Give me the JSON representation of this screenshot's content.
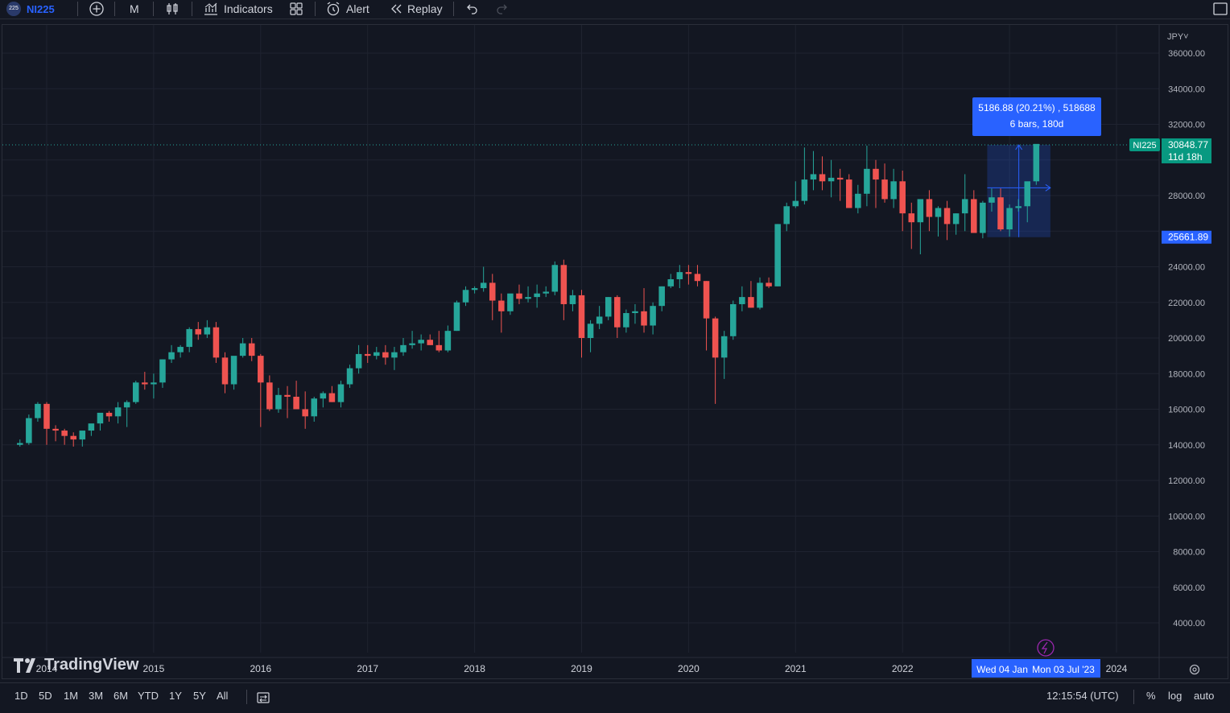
{
  "toolbar": {
    "symbol_badge": "225",
    "symbol": "NI225",
    "interval": "M",
    "indicators": "Indicators",
    "alert": "Alert",
    "replay": "Replay"
  },
  "chart_data": {
    "type": "candlestick",
    "currency": "JPY",
    "x_ticks": [
      "2014",
      "2015",
      "2016",
      "2017",
      "2018",
      "2019",
      "2020",
      "2021",
      "2022",
      "2024"
    ],
    "y_ticks": [
      "36000.00",
      "34000.00",
      "32000.00",
      "28000.00",
      "24000.00",
      "22000.00",
      "20000.00",
      "18000.00",
      "16000.00",
      "14000.00",
      "12000.00",
      "10000.00",
      "8000.00",
      "6000.00",
      "4000.00"
    ],
    "ylim": [
      3200,
      37000
    ],
    "colors": {
      "up": "#26a69a",
      "down": "#ef5350",
      "background": "#131722",
      "grid": "#1f2330"
    },
    "start": "2013-10",
    "ohlc": [
      [
        14000,
        14300,
        13900,
        14100
      ],
      [
        14100,
        15700,
        14000,
        15500
      ],
      [
        15500,
        16400,
        15300,
        16300
      ],
      [
        16300,
        16400,
        14000,
        14900
      ],
      [
        14900,
        15100,
        14200,
        14800
      ],
      [
        14800,
        14900,
        14000,
        14500
      ],
      [
        14500,
        14700,
        13900,
        14300
      ],
      [
        14300,
        14500,
        13900,
        14800
      ],
      [
        14800,
        15000,
        14500,
        15200
      ],
      [
        15200,
        15700,
        14800,
        15800
      ],
      [
        15800,
        15900,
        15300,
        15600
      ],
      [
        15600,
        16400,
        15200,
        16100
      ],
      [
        16100,
        16500,
        15000,
        16400
      ],
      [
        16400,
        17600,
        16300,
        17500
      ],
      [
        17500,
        18100,
        17100,
        17400
      ],
      [
        17400,
        18000,
        16600,
        17500
      ],
      [
        17500,
        18800,
        17200,
        18800
      ],
      [
        18800,
        19600,
        18600,
        19200
      ],
      [
        19200,
        19600,
        18900,
        19500
      ],
      [
        19500,
        20600,
        19200,
        20500
      ],
      [
        20500,
        20900,
        19900,
        20200
      ],
      [
        20200,
        21000,
        20000,
        20600
      ],
      [
        20600,
        20900,
        18600,
        18900
      ],
      [
        18900,
        19200,
        16900,
        17400
      ],
      [
        17400,
        18800,
        17100,
        19000
      ],
      [
        19000,
        20000,
        18900,
        19700
      ],
      [
        19700,
        20000,
        18700,
        19000
      ],
      [
        19000,
        19100,
        15000,
        17500
      ],
      [
        17500,
        17900,
        15900,
        16000
      ],
      [
        16000,
        17200,
        15800,
        16800
      ],
      [
        16800,
        17300,
        15500,
        16700
      ],
      [
        16700,
        17600,
        16000,
        16000
      ],
      [
        16000,
        17000,
        14900,
        15600
      ],
      [
        15600,
        16700,
        15300,
        16600
      ],
      [
        16600,
        17000,
        16100,
        16900
      ],
      [
        16900,
        17300,
        16400,
        16400
      ],
      [
        16400,
        17600,
        16100,
        17400
      ],
      [
        17400,
        18500,
        17200,
        18300
      ],
      [
        18300,
        19600,
        18000,
        19100
      ],
      [
        19100,
        19600,
        18600,
        19000
      ],
      [
        19000,
        19500,
        18800,
        19200
      ],
      [
        19200,
        19600,
        18500,
        18900
      ],
      [
        18900,
        19500,
        18200,
        19200
      ],
      [
        19200,
        20000,
        19000,
        19600
      ],
      [
        19600,
        20400,
        19400,
        19700
      ],
      [
        19700,
        20200,
        19300,
        19900
      ],
      [
        19900,
        20200,
        19600,
        19600
      ],
      [
        19600,
        20400,
        19200,
        19300
      ],
      [
        19300,
        20700,
        19200,
        20400
      ],
      [
        20400,
        22100,
        20400,
        22000
      ],
      [
        22000,
        22900,
        21800,
        22700
      ],
      [
        22700,
        22900,
        22500,
        22800
      ],
      [
        22800,
        24000,
        22600,
        23100
      ],
      [
        23100,
        23600,
        21000,
        22100
      ],
      [
        22100,
        22500,
        20300,
        21500
      ],
      [
        21500,
        22400,
        21300,
        22500
      ],
      [
        22500,
        23000,
        21900,
        22200
      ],
      [
        22200,
        22900,
        22000,
        22300
      ],
      [
        22300,
        23000,
        21700,
        22500
      ],
      [
        22500,
        22900,
        22300,
        22600
      ],
      [
        22600,
        24300,
        22400,
        24100
      ],
      [
        24100,
        24400,
        21000,
        21900
      ],
      [
        21900,
        22700,
        21500,
        22400
      ],
      [
        22400,
        22700,
        18900,
        20000
      ],
      [
        20000,
        21000,
        19200,
        20800
      ],
      [
        20800,
        21800,
        20500,
        21200
      ],
      [
        21200,
        22300,
        21000,
        22300
      ],
      [
        22300,
        22400,
        20000,
        20600
      ],
      [
        20600,
        21600,
        20300,
        21400
      ],
      [
        21400,
        21900,
        20800,
        21500
      ],
      [
        21500,
        22800,
        20300,
        20700
      ],
      [
        20700,
        22000,
        20200,
        21800
      ],
      [
        21800,
        22900,
        21500,
        22900
      ],
      [
        22900,
        23600,
        22800,
        23300
      ],
      [
        23300,
        24100,
        22800,
        23700
      ],
      [
        23700,
        24100,
        23000,
        23600
      ],
      [
        23600,
        24100,
        22900,
        23200
      ],
      [
        23200,
        23200,
        19300,
        21100
      ],
      [
        21100,
        21200,
        16300,
        18900
      ],
      [
        18900,
        20400,
        17700,
        20100
      ],
      [
        20100,
        22100,
        19900,
        21900
      ],
      [
        21900,
        22900,
        21500,
        22300
      ],
      [
        22300,
        23200,
        21700,
        21700
      ],
      [
        21700,
        23400,
        21600,
        23100
      ],
      [
        23100,
        23400,
        22800,
        22900
      ],
      [
        22900,
        26400,
        22900,
        26400
      ],
      [
        26400,
        27600,
        26000,
        27400
      ],
      [
        27400,
        28800,
        27300,
        27700
      ],
      [
        27700,
        30700,
        27500,
        28900
      ],
      [
        28900,
        30500,
        28300,
        29200
      ],
      [
        29200,
        30200,
        28300,
        28800
      ],
      [
        28800,
        30000,
        27900,
        29000
      ],
      [
        29000,
        29500,
        27700,
        28900
      ],
      [
        28900,
        29200,
        27300,
        27300
      ],
      [
        27300,
        28600,
        27000,
        28100
      ],
      [
        28100,
        30800,
        27400,
        29500
      ],
      [
        29500,
        30000,
        27300,
        28900
      ],
      [
        28900,
        29800,
        27600,
        27800
      ],
      [
        27800,
        29500,
        27300,
        28800
      ],
      [
        28800,
        29400,
        26000,
        27000
      ],
      [
        27000,
        27600,
        25000,
        26500
      ],
      [
        26500,
        27500,
        24700,
        27800
      ],
      [
        27800,
        28300,
        26000,
        26800
      ],
      [
        26800,
        27400,
        25700,
        27300
      ],
      [
        27300,
        27700,
        25500,
        26400
      ],
      [
        26400,
        27000,
        25800,
        27000
      ],
      [
        27000,
        29200,
        26000,
        27800
      ],
      [
        27800,
        28300,
        26000,
        25900
      ],
      [
        25900,
        27700,
        25600,
        27600
      ],
      [
        27600,
        28400,
        27100,
        27900
      ],
      [
        27900,
        28400,
        26000,
        26100
      ],
      [
        26100,
        27500,
        25700,
        27300
      ],
      [
        27300,
        27800,
        27100,
        27400
      ],
      [
        27400,
        28000,
        26500,
        28800
      ],
      [
        28800,
        29600,
        28600,
        30900
      ]
    ],
    "last_price": "30848.77",
    "countdown": "11d 18h",
    "lower_price_label": "25661.89",
    "measure": {
      "line1": "5186.88 (20.21%) , 518688",
      "line2": "6 bars, 180d",
      "date_from": "Wed 04 Jan",
      "date_to": "Mon 03 Jul '23",
      "price_from": 25661.89,
      "price_to": 30848.77
    }
  },
  "brand": "TradingView",
  "bottom": {
    "ranges": [
      "1D",
      "5D",
      "1M",
      "3M",
      "6M",
      "YTD",
      "1Y",
      "5Y",
      "All"
    ],
    "clock": "12:15:54 (UTC)",
    "percent": "%",
    "log": "log",
    "auto": "auto"
  }
}
